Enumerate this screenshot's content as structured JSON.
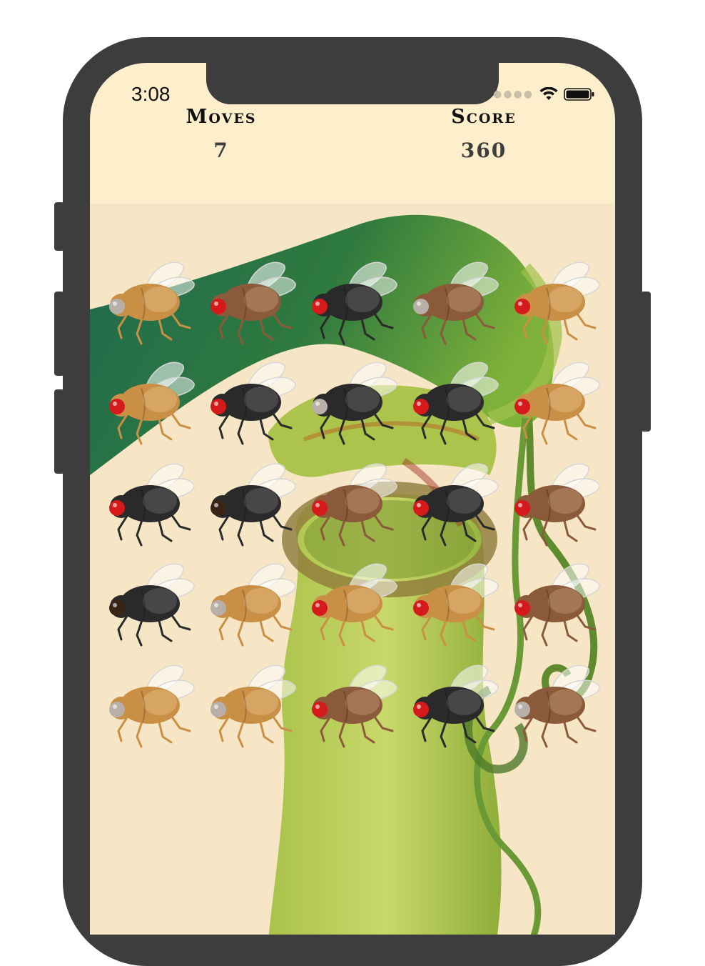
{
  "status": {
    "time": "3:08"
  },
  "hud": {
    "moves_label": "Moves",
    "moves_value": "7",
    "score_label": "Score",
    "score_value": "360"
  },
  "palette": {
    "ginger": {
      "body": "#c98f45",
      "wing_tint": "#e7c28a",
      "eye": "#d01515"
    },
    "brown": {
      "body": "#8a5a3a",
      "wing_tint": "#c0997a",
      "eye": "#d01515"
    },
    "black": {
      "body": "#2a2a2a",
      "wing_tint": "#6a6a6a",
      "eye": "#d01515"
    }
  },
  "board": {
    "rows": [
      [
        {
          "kind": "ginger",
          "eye": "grey"
        },
        {
          "kind": "brown",
          "eye": "red"
        },
        {
          "kind": "black",
          "eye": "red"
        },
        {
          "kind": "brown",
          "eye": "grey"
        },
        {
          "kind": "ginger",
          "eye": "red"
        }
      ],
      [
        {
          "kind": "ginger",
          "eye": "red"
        },
        {
          "kind": "black",
          "eye": "red"
        },
        {
          "kind": "black",
          "eye": "grey"
        },
        {
          "kind": "black",
          "eye": "red"
        },
        {
          "kind": "ginger",
          "eye": "red"
        }
      ],
      [
        {
          "kind": "black",
          "eye": "red"
        },
        {
          "kind": "black",
          "eye": "dark"
        },
        {
          "kind": "brown",
          "eye": "red"
        },
        {
          "kind": "black",
          "eye": "red"
        },
        {
          "kind": "brown",
          "eye": "red"
        }
      ],
      [
        {
          "kind": "black",
          "eye": "dark"
        },
        {
          "kind": "ginger",
          "eye": "grey"
        },
        {
          "kind": "ginger",
          "eye": "red"
        },
        {
          "kind": "ginger",
          "eye": "red"
        },
        {
          "kind": "brown",
          "eye": "red"
        }
      ],
      [
        {
          "kind": "ginger",
          "eye": "grey"
        },
        {
          "kind": "ginger",
          "eye": "grey"
        },
        {
          "kind": "brown",
          "eye": "red"
        },
        {
          "kind": "black",
          "eye": "red"
        },
        {
          "kind": "brown",
          "eye": "grey"
        }
      ]
    ]
  }
}
